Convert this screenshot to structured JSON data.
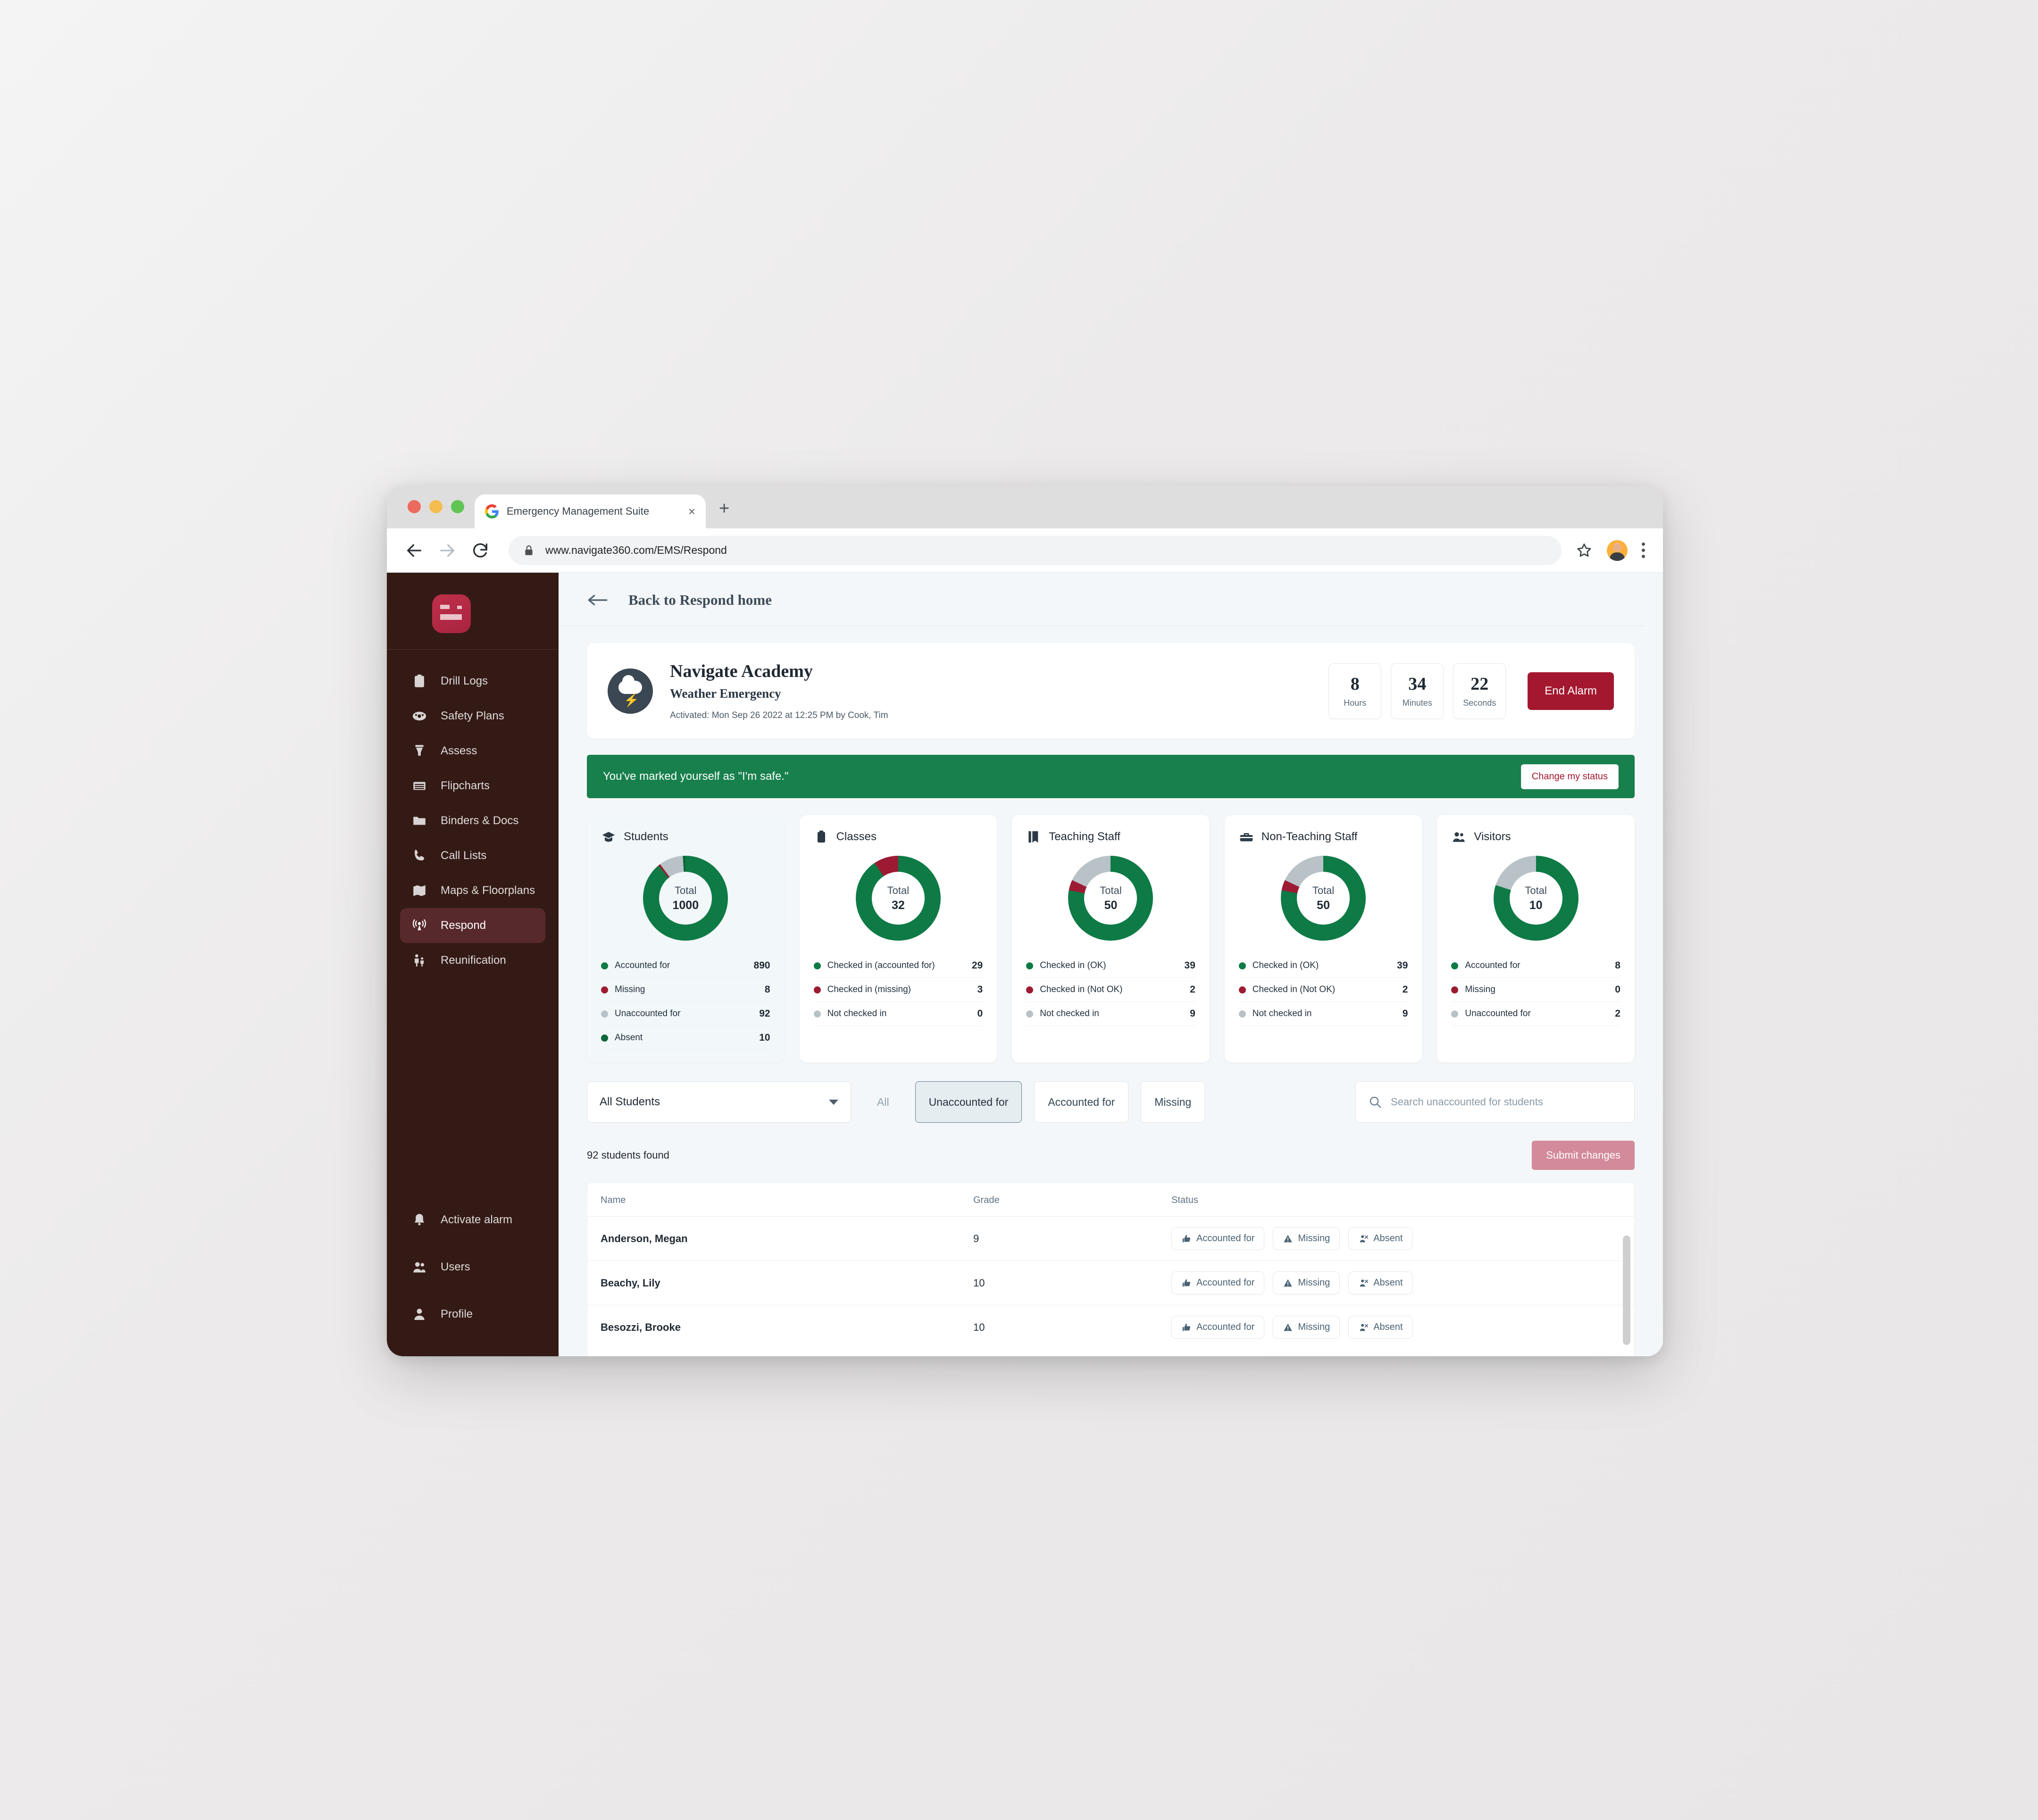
{
  "browser": {
    "tab_title": "Emergency Management Suite",
    "tab_close_glyph": "×",
    "new_tab_glyph": "+",
    "url": "www.navigate360.com/EMS/Respond",
    "icons": {
      "back": "back-arrow-icon",
      "forward": "forward-arrow-icon",
      "reload": "reload-icon",
      "lock": "lock-icon",
      "star": "bookmark-star-icon",
      "profile": "profile-avatar-icon",
      "menu": "kebab-menu-icon"
    }
  },
  "sidebar": {
    "logo_name": "navigate360-logo",
    "items": [
      {
        "label": "Drill Logs",
        "icon": "clipboard-icon",
        "active": false
      },
      {
        "label": "Safety Plans",
        "icon": "shield-team-icon",
        "active": false
      },
      {
        "label": "Assess",
        "icon": "funnel-icon",
        "active": false
      },
      {
        "label": "Flipcharts",
        "icon": "flipchart-icon",
        "active": false
      },
      {
        "label": "Binders & Docs",
        "icon": "folder-icon",
        "active": false
      },
      {
        "label": "Call Lists",
        "icon": "phone-icon",
        "active": false
      },
      {
        "label": "Maps & Floorplans",
        "icon": "map-icon",
        "active": false
      },
      {
        "label": "Respond",
        "icon": "broadcast-icon",
        "active": true
      },
      {
        "label": "Reunification",
        "icon": "family-icon",
        "active": false
      }
    ],
    "bottom_items": [
      {
        "label": "Activate alarm",
        "icon": "bell-icon"
      },
      {
        "label": "Users",
        "icon": "users-icon"
      },
      {
        "label": "Profile",
        "icon": "person-icon"
      }
    ]
  },
  "back_bar": {
    "label": "Back to Respond home",
    "icon": "left-arrow-icon"
  },
  "alarm": {
    "badge_icon": "storm-cloud-icon",
    "school_name": "Navigate Academy",
    "alarm_type": "Weather Emergency",
    "activated_line": "Activated: Mon Sep 26 2022 at 12:25 PM by Cook, Tim",
    "timer": [
      {
        "value": "8",
        "label": "Hours"
      },
      {
        "value": "34",
        "label": "Minutes"
      },
      {
        "value": "22",
        "label": "Seconds"
      }
    ],
    "end_alarm_label": "End Alarm",
    "end_alarm_color": "#a4182f"
  },
  "safe_banner": {
    "text": "You've marked yourself as \"I'm safe.\"",
    "button_label": "Change my status",
    "background": "#17804c"
  },
  "colors": {
    "green": "#0e7a46",
    "dark_green": "#0b6639",
    "red": "#9c1b33",
    "gray": "#b8c2c7"
  },
  "chart_data": [
    {
      "type": "pie",
      "title": "Students",
      "icon": "graduation-cap-icon",
      "selected": true,
      "total_label": "Total",
      "total": 1000,
      "categories": [
        "Accounted for",
        "Missing",
        "Unaccounted for",
        "Absent"
      ],
      "values": [
        890,
        8,
        92,
        10
      ],
      "colors": [
        "#0e7a46",
        "#9c1b33",
        "#b8c2c7",
        "#0b6639"
      ],
      "legend_position": "below"
    },
    {
      "type": "pie",
      "title": "Classes",
      "icon": "clipboard-icon",
      "selected": false,
      "total_label": "Total",
      "total": 32,
      "categories": [
        "Checked in (accounted for)",
        "Checked in (missing)",
        "Not checked in"
      ],
      "values": [
        29,
        3,
        0
      ],
      "colors": [
        "#0e7a46",
        "#9c1b33",
        "#b8c2c7"
      ],
      "legend_position": "below"
    },
    {
      "type": "pie",
      "title": "Teaching Staff",
      "icon": "book-icon",
      "selected": false,
      "total_label": "Total",
      "total": 50,
      "categories": [
        "Checked in (OK)",
        "Checked in (Not OK)",
        "Not checked in"
      ],
      "values": [
        39,
        2,
        9
      ],
      "colors": [
        "#0e7a46",
        "#9c1b33",
        "#b8c2c7"
      ],
      "legend_position": "below"
    },
    {
      "type": "pie",
      "title": "Non-Teaching Staff",
      "icon": "toolbox-icon",
      "selected": false,
      "total_label": "Total",
      "total": 50,
      "categories": [
        "Checked in (OK)",
        "Checked in (Not OK)",
        "Not checked in"
      ],
      "values": [
        39,
        2,
        9
      ],
      "colors": [
        "#0e7a46",
        "#9c1b33",
        "#b8c2c7"
      ],
      "legend_position": "below"
    },
    {
      "type": "pie",
      "title": "Visitors",
      "icon": "visitors-icon",
      "selected": false,
      "total_label": "Total",
      "total": 10,
      "categories": [
        "Accounted for",
        "Missing",
        "Unaccounted for"
      ],
      "values": [
        8,
        0,
        2
      ],
      "colors": [
        "#0e7a46",
        "#9c1b33",
        "#b8c2c7"
      ],
      "legend_position": "below"
    }
  ],
  "filters": {
    "select_value": "All Students",
    "tabs": [
      {
        "label": "All",
        "state": "ghost"
      },
      {
        "label": "Unaccounted for",
        "state": "active"
      },
      {
        "label": "Accounted for",
        "state": "normal"
      },
      {
        "label": "Missing",
        "state": "normal"
      }
    ],
    "search_placeholder": "Search unaccounted for students",
    "search_value": "",
    "search_icon": "search-icon"
  },
  "results": {
    "found_text": "92 students found",
    "submit_label": "Submit changes"
  },
  "table": {
    "columns": [
      "Name",
      "Grade",
      "Status"
    ],
    "action_labels": [
      "Accounted for",
      "Missing",
      "Absent"
    ],
    "action_icons": [
      "thumbs-up-icon",
      "warning-triangle-icon",
      "absent-person-icon"
    ],
    "rows": [
      {
        "name": "Anderson, Megan",
        "grade": "9"
      },
      {
        "name": "Beachy, Lily",
        "grade": "10"
      },
      {
        "name": "Besozzi, Brooke",
        "grade": "10"
      }
    ]
  }
}
